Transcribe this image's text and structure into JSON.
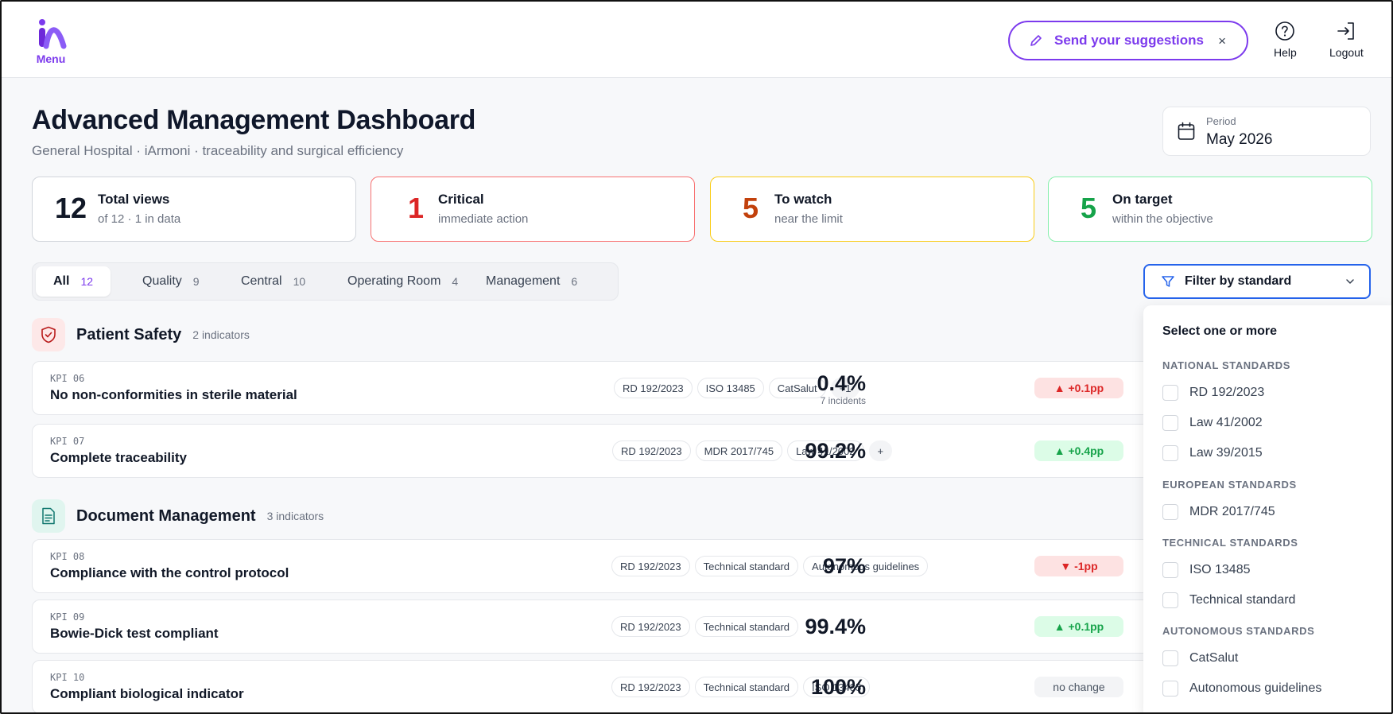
{
  "header": {
    "menu_label": "Menu",
    "suggest_label": "Send your suggestions",
    "suggest_close": "×",
    "help_label": "Help",
    "logout_label": "Logout"
  },
  "page": {
    "title": "Advanced Management Dashboard",
    "subtitle": "General Hospital · iArmoni · traceability and surgical efficiency",
    "period_label": "Period",
    "period_value": "May 2026"
  },
  "stats": [
    {
      "num": "12",
      "title": "Total views",
      "sub": "of 12 · 1 in data"
    },
    {
      "num": "1",
      "title": "Critical",
      "sub": "immediate action"
    },
    {
      "num": "5",
      "title": "To watch",
      "sub": "near the limit"
    },
    {
      "num": "5",
      "title": "On target",
      "sub": "within the objective"
    }
  ],
  "tabs": [
    {
      "label": "All",
      "count": "12"
    },
    {
      "label": "Quality",
      "count": "9"
    },
    {
      "label": "Central",
      "count": "10"
    },
    {
      "label": "Operating Room",
      "count": "4"
    },
    {
      "label": "Management",
      "count": "6"
    }
  ],
  "filter": {
    "label": "Filter by standard",
    "heading": "Select one or more",
    "groups": [
      {
        "title": "NATIONAL STANDARDS",
        "items": [
          "RD 192/2023",
          "Law 41/2002",
          "Law 39/2015"
        ]
      },
      {
        "title": "EUROPEAN STANDARDS",
        "items": [
          "MDR 2017/745"
        ]
      },
      {
        "title": "TECHNICAL STANDARDS",
        "items": [
          "ISO 13485",
          "Technical standard"
        ]
      },
      {
        "title": "AUTONOMOUS STANDARDS",
        "items": [
          "CatSalut",
          "Autonomous guidelines"
        ]
      }
    ]
  },
  "sections": [
    {
      "title": "Patient Safety",
      "count": "2 indicators",
      "kpis": [
        {
          "code": "KPI 06",
          "name": "No non-conformities in sterile material",
          "tags": [
            "RD 192/2023",
            "ISO 13485",
            "CatSalut",
            "+1"
          ],
          "value": "0.4%",
          "sub": "7 incidents",
          "delta": "▲ +0.1pp"
        },
        {
          "code": "KPI 07",
          "name": "Complete traceability",
          "tags": [
            "RD 192/2023",
            "MDR 2017/745",
            "Law 41/2002",
            "+"
          ],
          "value": "99.2%",
          "sub": "",
          "delta": "▲ +0.4pp"
        }
      ]
    },
    {
      "title": "Document Management",
      "count": "3 indicators",
      "kpis": [
        {
          "code": "KPI 08",
          "name": "Compliance with the control protocol",
          "tags": [
            "RD 192/2023",
            "Technical standard",
            "Autonomous guidelines"
          ],
          "value": "97%",
          "sub": "",
          "delta": "▼ -1pp"
        },
        {
          "code": "KPI 09",
          "name": "Bowie-Dick test compliant",
          "tags": [
            "RD 192/2023",
            "Technical standard"
          ],
          "value": "99.4%",
          "sub": "",
          "delta": "▲ +0.1pp"
        },
        {
          "code": "KPI 10",
          "name": "Compliant biological indicator",
          "tags": [
            "RD 192/2023",
            "Technical standard",
            "ISO 13485"
          ],
          "value": "100%",
          "sub": "",
          "delta": "no change"
        }
      ]
    }
  ],
  "colors": {
    "accent": "#7c3aed",
    "critical": "#dc2626",
    "watch": "#c2410c",
    "ok": "#16a34a",
    "filter_border": "#2563eb"
  },
  "icons": [
    "menu-logo-icon",
    "pencil-icon",
    "close-icon",
    "help-icon",
    "logout-icon",
    "calendar-icon",
    "filter-icon",
    "chevron-down-icon",
    "shield-check-icon",
    "document-icon"
  ]
}
